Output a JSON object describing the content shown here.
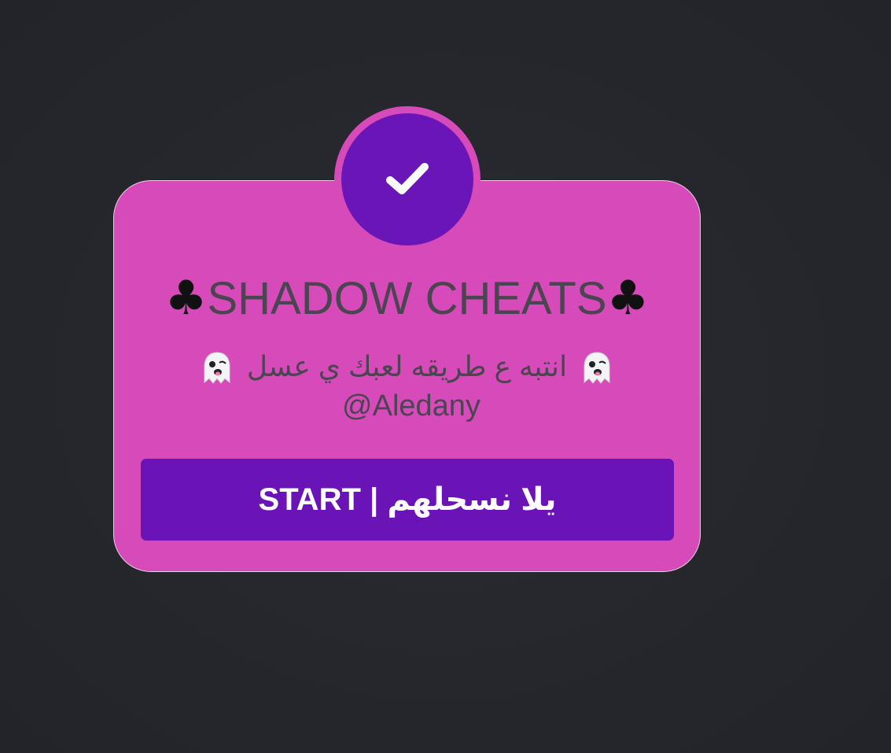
{
  "badge": {
    "icon": "checkmark-icon",
    "ring_color": "#d74ab9",
    "fill_color": "#6915b8"
  },
  "card": {
    "background": "#d74ab9",
    "title": "SHADOW CHEATS",
    "title_icon": "club-suit-icon",
    "title_icon_glyph": "♣",
    "subtitle": "انتبه ع طريقه لعبك ي عسل",
    "subtitle_icon": "ghost-icon",
    "handle": "@Aledany"
  },
  "start_button": {
    "label": "START | يلا نسحلهم",
    "background": "#6a14b8"
  }
}
